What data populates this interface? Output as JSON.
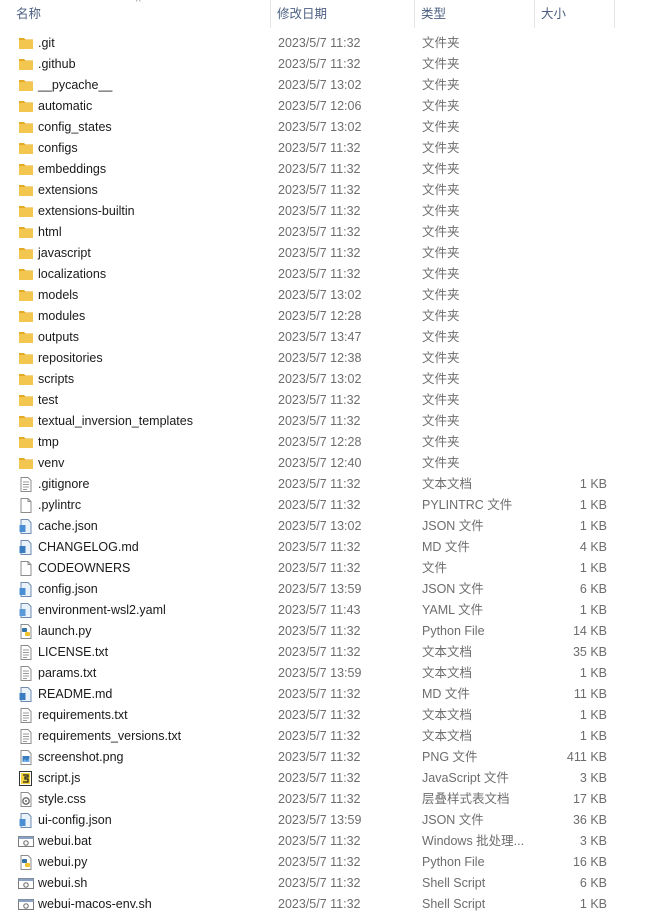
{
  "header": {
    "name": "名称",
    "date": "修改日期",
    "type": "类型",
    "size": "大小",
    "sort_arrow": "^"
  },
  "colors": {
    "header_text": "#4d6082",
    "folder": "#f3c74f",
    "folder_dark": "#e3aa23"
  },
  "files": [
    {
      "name": ".git",
      "date": "2023/5/7 11:32",
      "type": "文件夹",
      "size": "",
      "icon": "folder-icon"
    },
    {
      "name": ".github",
      "date": "2023/5/7 11:32",
      "type": "文件夹",
      "size": "",
      "icon": "folder-icon"
    },
    {
      "name": "__pycache__",
      "date": "2023/5/7 13:02",
      "type": "文件夹",
      "size": "",
      "icon": "folder-icon"
    },
    {
      "name": "automatic",
      "date": "2023/5/7 12:06",
      "type": "文件夹",
      "size": "",
      "icon": "folder-icon"
    },
    {
      "name": "config_states",
      "date": "2023/5/7 13:02",
      "type": "文件夹",
      "size": "",
      "icon": "folder-icon"
    },
    {
      "name": "configs",
      "date": "2023/5/7 11:32",
      "type": "文件夹",
      "size": "",
      "icon": "folder-icon"
    },
    {
      "name": "embeddings",
      "date": "2023/5/7 11:32",
      "type": "文件夹",
      "size": "",
      "icon": "folder-icon"
    },
    {
      "name": "extensions",
      "date": "2023/5/7 11:32",
      "type": "文件夹",
      "size": "",
      "icon": "folder-icon"
    },
    {
      "name": "extensions-builtin",
      "date": "2023/5/7 11:32",
      "type": "文件夹",
      "size": "",
      "icon": "folder-icon"
    },
    {
      "name": "html",
      "date": "2023/5/7 11:32",
      "type": "文件夹",
      "size": "",
      "icon": "folder-icon"
    },
    {
      "name": "javascript",
      "date": "2023/5/7 11:32",
      "type": "文件夹",
      "size": "",
      "icon": "folder-icon"
    },
    {
      "name": "localizations",
      "date": "2023/5/7 11:32",
      "type": "文件夹",
      "size": "",
      "icon": "folder-icon"
    },
    {
      "name": "models",
      "date": "2023/5/7 13:02",
      "type": "文件夹",
      "size": "",
      "icon": "folder-icon"
    },
    {
      "name": "modules",
      "date": "2023/5/7 12:28",
      "type": "文件夹",
      "size": "",
      "icon": "folder-icon"
    },
    {
      "name": "outputs",
      "date": "2023/5/7 13:47",
      "type": "文件夹",
      "size": "",
      "icon": "folder-icon"
    },
    {
      "name": "repositories",
      "date": "2023/5/7 12:38",
      "type": "文件夹",
      "size": "",
      "icon": "folder-icon"
    },
    {
      "name": "scripts",
      "date": "2023/5/7 13:02",
      "type": "文件夹",
      "size": "",
      "icon": "folder-icon"
    },
    {
      "name": "test",
      "date": "2023/5/7 11:32",
      "type": "文件夹",
      "size": "",
      "icon": "folder-icon"
    },
    {
      "name": "textual_inversion_templates",
      "date": "2023/5/7 11:32",
      "type": "文件夹",
      "size": "",
      "icon": "folder-icon"
    },
    {
      "name": "tmp",
      "date": "2023/5/7 12:28",
      "type": "文件夹",
      "size": "",
      "icon": "folder-icon"
    },
    {
      "name": "venv",
      "date": "2023/5/7 12:40",
      "type": "文件夹",
      "size": "",
      "icon": "folder-icon"
    },
    {
      "name": ".gitignore",
      "date": "2023/5/7 11:32",
      "type": "文本文档",
      "size": "1 KB",
      "icon": "text-file-icon"
    },
    {
      "name": ".pylintrc",
      "date": "2023/5/7 11:32",
      "type": "PYLINTRC 文件",
      "size": "1 KB",
      "icon": "blank-file-icon"
    },
    {
      "name": "cache.json",
      "date": "2023/5/7 13:02",
      "type": "JSON 文件",
      "size": "1 KB",
      "icon": "json-file-icon"
    },
    {
      "name": "CHANGELOG.md",
      "date": "2023/5/7 11:32",
      "type": "MD 文件",
      "size": "4 KB",
      "icon": "md-file-icon"
    },
    {
      "name": "CODEOWNERS",
      "date": "2023/5/7 11:32",
      "type": "文件",
      "size": "1 KB",
      "icon": "blank-file-icon"
    },
    {
      "name": "config.json",
      "date": "2023/5/7 13:59",
      "type": "JSON 文件",
      "size": "6 KB",
      "icon": "json-file-icon"
    },
    {
      "name": "environment-wsl2.yaml",
      "date": "2023/5/7 11:43",
      "type": "YAML 文件",
      "size": "1 KB",
      "icon": "yaml-file-icon"
    },
    {
      "name": "launch.py",
      "date": "2023/5/7 11:32",
      "type": "Python File",
      "size": "14 KB",
      "icon": "python-file-icon"
    },
    {
      "name": "LICENSE.txt",
      "date": "2023/5/7 11:32",
      "type": "文本文档",
      "size": "35 KB",
      "icon": "text-file-icon"
    },
    {
      "name": "params.txt",
      "date": "2023/5/7 13:59",
      "type": "文本文档",
      "size": "1 KB",
      "icon": "text-file-icon"
    },
    {
      "name": "README.md",
      "date": "2023/5/7 11:32",
      "type": "MD 文件",
      "size": "11 KB",
      "icon": "md-file-icon"
    },
    {
      "name": "requirements.txt",
      "date": "2023/5/7 11:32",
      "type": "文本文档",
      "size": "1 KB",
      "icon": "text-file-icon"
    },
    {
      "name": "requirements_versions.txt",
      "date": "2023/5/7 11:32",
      "type": "文本文档",
      "size": "1 KB",
      "icon": "text-file-icon"
    },
    {
      "name": "screenshot.png",
      "date": "2023/5/7 11:32",
      "type": "PNG 文件",
      "size": "411 KB",
      "icon": "image-file-icon"
    },
    {
      "name": "script.js",
      "date": "2023/5/7 11:32",
      "type": "JavaScript 文件",
      "size": "3 KB",
      "icon": "script-file-icon"
    },
    {
      "name": "style.css",
      "date": "2023/5/7 11:32",
      "type": "层叠样式表文档",
      "size": "17 KB",
      "icon": "css-file-icon"
    },
    {
      "name": "ui-config.json",
      "date": "2023/5/7 13:59",
      "type": "JSON 文件",
      "size": "36 KB",
      "icon": "json-file-icon"
    },
    {
      "name": "webui.bat",
      "date": "2023/5/7 11:32",
      "type": "Windows 批处理...",
      "size": "3 KB",
      "icon": "batch-file-icon"
    },
    {
      "name": "webui.py",
      "date": "2023/5/7 11:32",
      "type": "Python File",
      "size": "16 KB",
      "icon": "python-file-icon"
    },
    {
      "name": "webui.sh",
      "date": "2023/5/7 11:32",
      "type": "Shell Script",
      "size": "6 KB",
      "icon": "shell-file-icon"
    },
    {
      "name": "webui-macos-env.sh",
      "date": "2023/5/7 11:32",
      "type": "Shell Script",
      "size": "1 KB",
      "icon": "shell-file-icon"
    }
  ]
}
